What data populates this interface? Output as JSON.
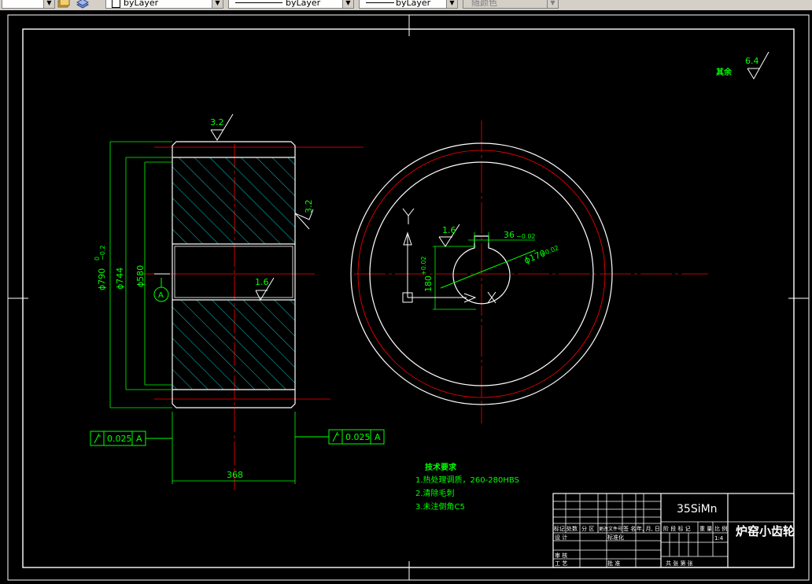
{
  "toolbar": {
    "layer_color": "byLayer",
    "linetype": "byLayer",
    "lineweight": "byLayer",
    "plot_style": "随颜色",
    "icons": [
      "layer-states-icon",
      "layer-previous-icon"
    ]
  },
  "colors": {
    "background": "#000000",
    "outline": "#ffffff",
    "centerline": "#ff0000",
    "dimension": "#00ff00",
    "hatch": "#00c8c8"
  },
  "drawing": {
    "roughness_default": "6.4",
    "roughness_default_label": "其余",
    "roughness_top": "3.2",
    "roughness_right": "3.2",
    "roughness_bore": "1.6",
    "roughness_keyway": "1.6",
    "dim_outer_dia": "ϕ790",
    "dim_outer_tol_upper": "0",
    "dim_outer_tol_lower": "−0.2",
    "dim_root_dia": "ϕ744",
    "dim_hub_dia": "ϕ580",
    "dim_width": "368",
    "dim_keyway_width": "36",
    "dim_keyway_tol": "−0.02",
    "dim_keyway_depth": "180",
    "dim_keyway_depth_tol": "+0.02",
    "dim_bore_dia": "ϕ170",
    "dim_bore_tol": "+0.02",
    "datum_label": "A",
    "tolerance_left_value": "0.025",
    "tolerance_left_datum": "A",
    "tolerance_right_value": "0.025",
    "tolerance_right_datum": "A",
    "axis_y": "Y",
    "axis_x": "X",
    "tech_title": "技术要求",
    "tech_items": [
      "1.热处理调质，260-280HBS",
      "2.清除毛刺",
      "3.未注倒角C5"
    ]
  },
  "title_block": {
    "material": "35SiMn",
    "part_name": "炉窑小齿轮",
    "scale": "1:4",
    "row_header": [
      "标记",
      "处数",
      "分 区",
      "更改文件号",
      "签 名",
      "年, 月, 日"
    ],
    "design_label": "设 计",
    "standardization_label": "标准化",
    "review_label": "审 核",
    "process_label": "工 艺",
    "approve_label": "批 准",
    "stage_label": "阶 段 标 记",
    "weight_label": "重 量",
    "scale_label": "比 例",
    "sheets_label": "共   张   第   张"
  }
}
